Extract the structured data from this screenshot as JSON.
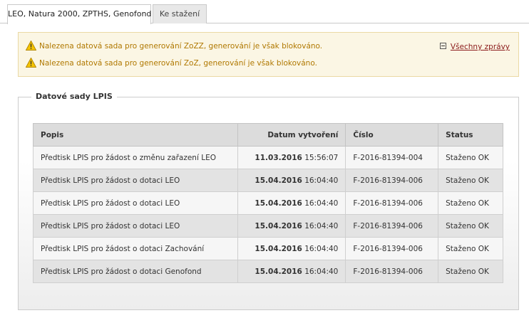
{
  "tabs": [
    {
      "label": "LEO, Natura 2000, ZPTHS, Genofond",
      "active": true
    },
    {
      "label": "Ke stažení",
      "active": false
    }
  ],
  "messages": {
    "items": [
      {
        "icon": "warning-icon",
        "text": "Nalezena datová sada pro generování ZoZZ, generování je však blokováno."
      },
      {
        "icon": "warning-icon",
        "text": "Nalezena datová sada pro generování ZoZ, generování je však blokováno."
      }
    ],
    "toggle_icon": "collapse-icon",
    "all_link": "Všechny zprávy"
  },
  "section": {
    "legend": "Datové sady LPIS"
  },
  "table": {
    "headers": [
      "Popis",
      "Datum vytvoření",
      "Číslo",
      "Status"
    ],
    "rows": [
      {
        "popis": "Předtisk LPIS pro žádost o změnu zařazení LEO",
        "date": "11.03.2016",
        "time": "15:56:07",
        "cislo": "F-2016-81394-004",
        "status": "Staženo OK"
      },
      {
        "popis": "Předtisk LPIS pro žádost o dotaci LEO",
        "date": "15.04.2016",
        "time": "16:04:40",
        "cislo": "F-2016-81394-006",
        "status": "Staženo OK"
      },
      {
        "popis": "Předtisk LPIS pro žádost o dotaci LEO",
        "date": "15.04.2016",
        "time": "16:04:40",
        "cislo": "F-2016-81394-006",
        "status": "Staženo OK"
      },
      {
        "popis": "Předtisk LPIS pro žádost o dotaci LEO",
        "date": "15.04.2016",
        "time": "16:04:40",
        "cislo": "F-2016-81394-006",
        "status": "Staženo OK"
      },
      {
        "popis": "Předtisk LPIS pro žádost o dotaci Zachování",
        "date": "15.04.2016",
        "time": "16:04:40",
        "cislo": "F-2016-81394-006",
        "status": "Staženo OK"
      },
      {
        "popis": "Předtisk LPIS pro žádost o dotaci Genofond",
        "date": "15.04.2016",
        "time": "16:04:40",
        "cislo": "F-2016-81394-006",
        "status": "Staženo OK"
      }
    ]
  },
  "colors": {
    "warning_text": "#b07800",
    "warning_bg": "#fbf6e4",
    "link": "#8b1a1a",
    "header_bg": "#dcdcdc"
  }
}
